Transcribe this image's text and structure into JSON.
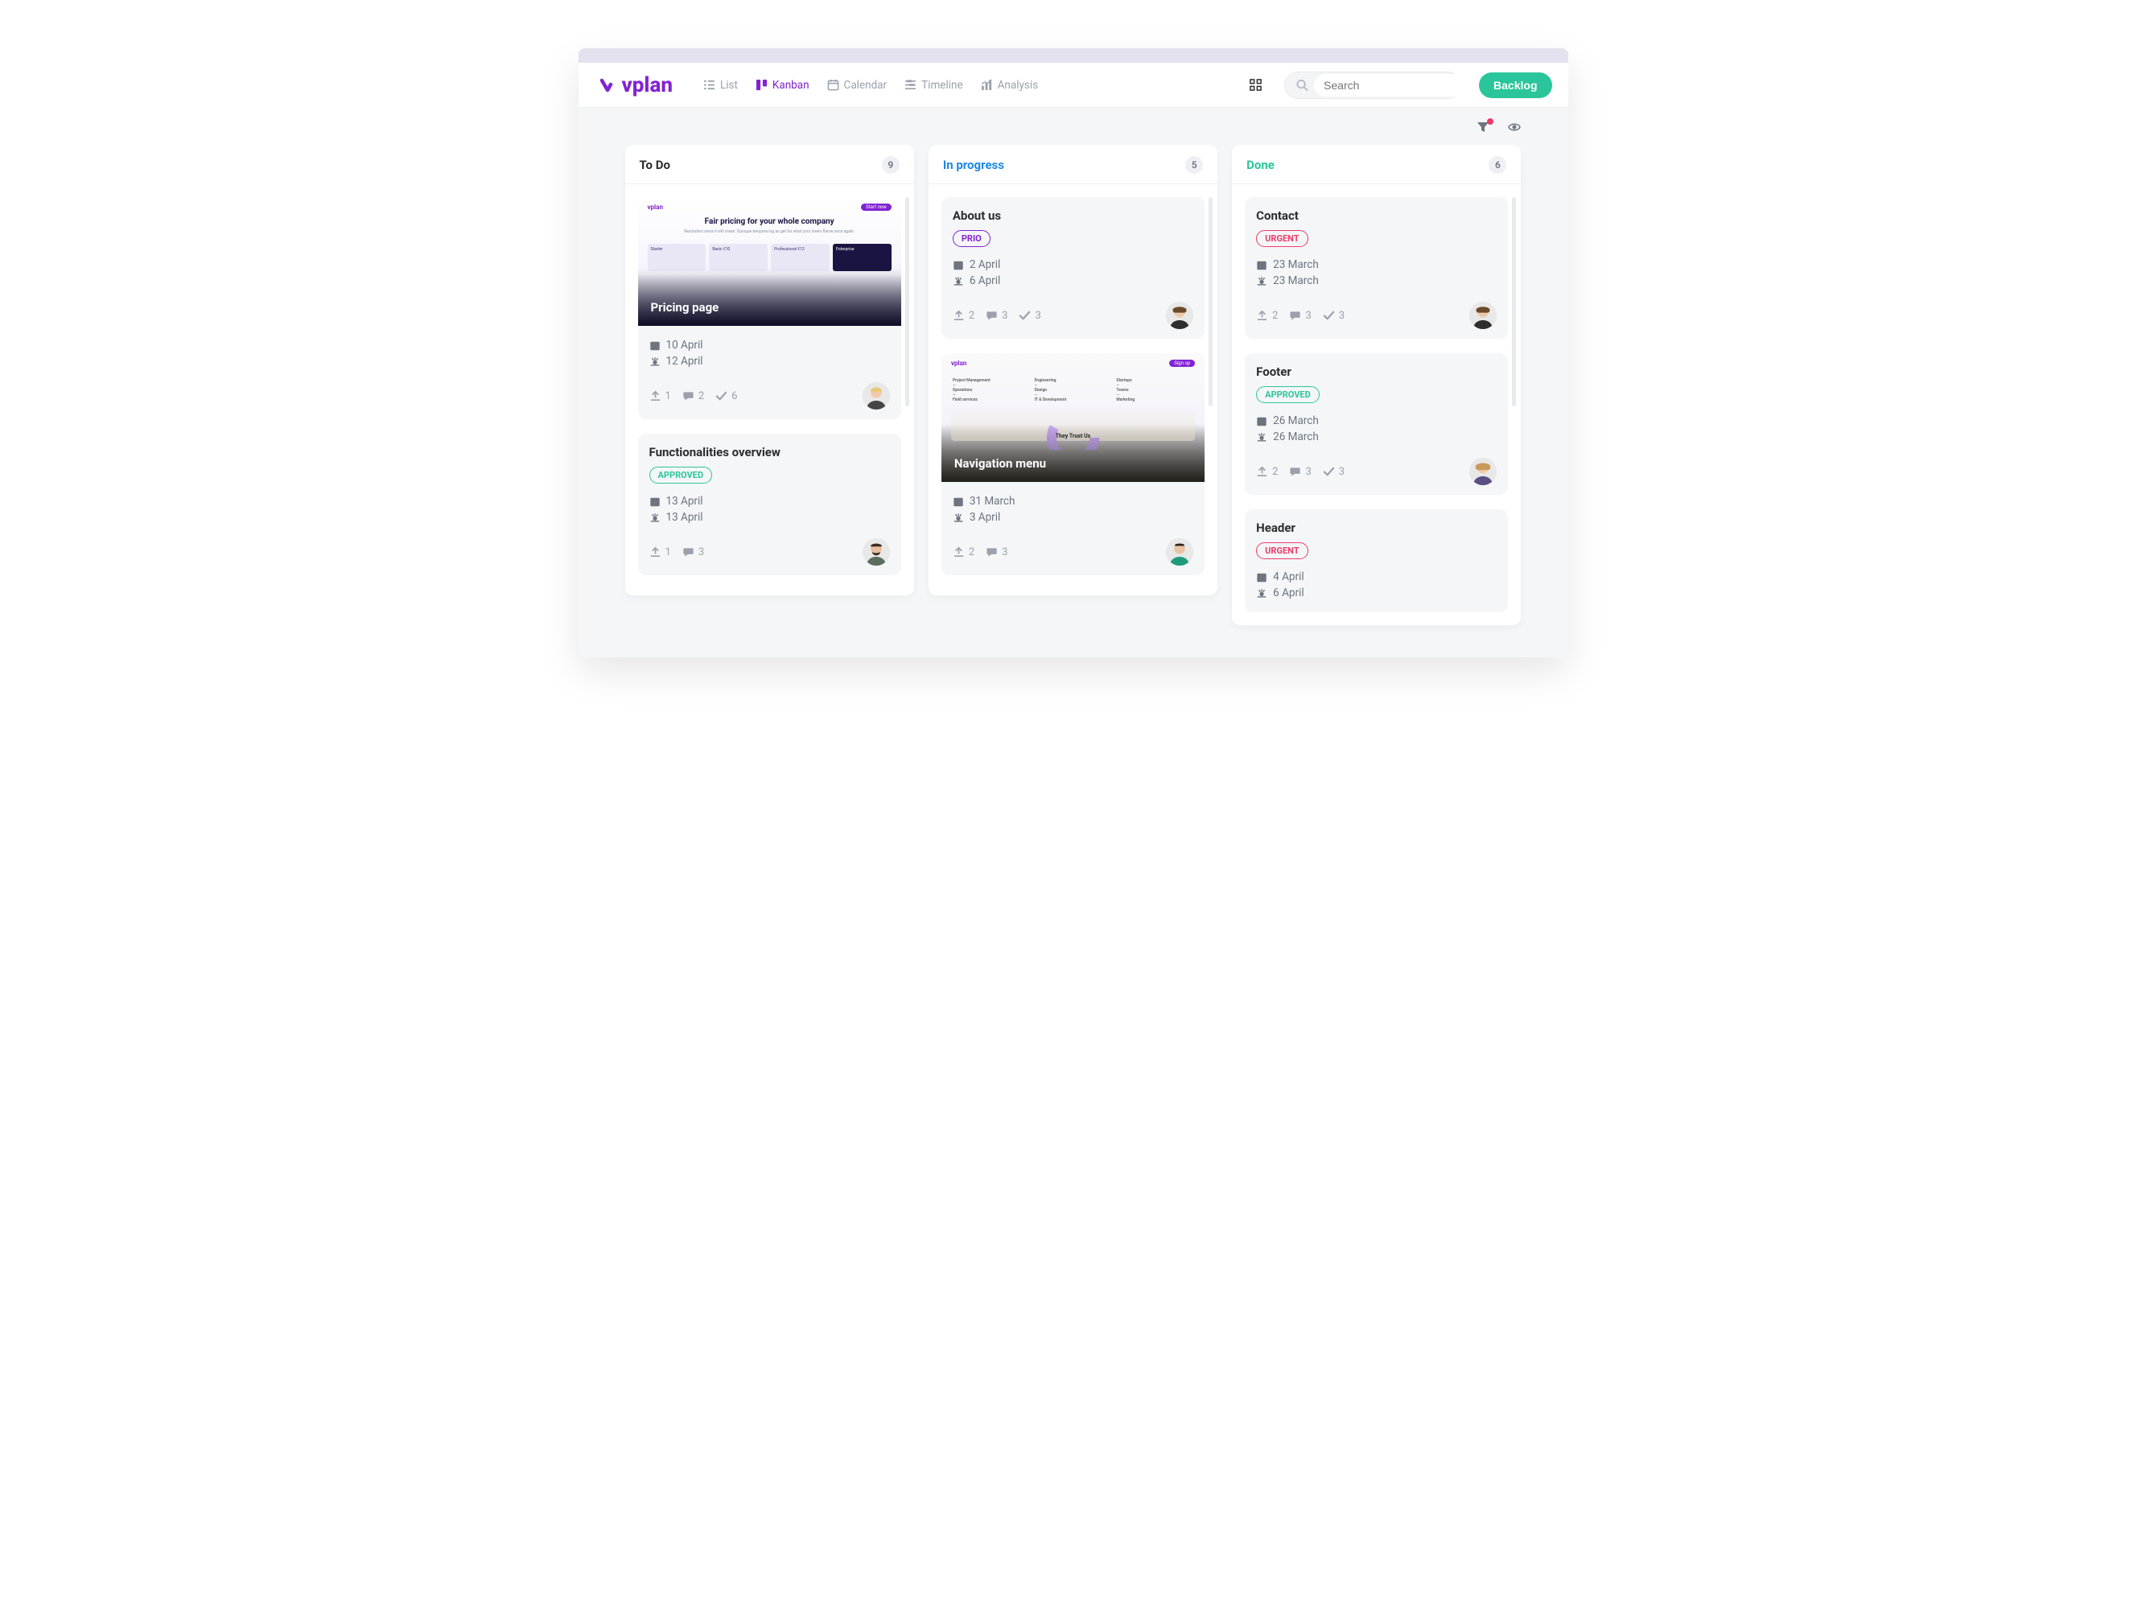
{
  "app": {
    "name": "vplan"
  },
  "nav": {
    "views": {
      "list": "List",
      "kanban": "Kanban",
      "calendar": "Calendar",
      "timeline": "Timeline",
      "analysis": "Analysis"
    },
    "active_view": "kanban",
    "search_placeholder": "Search",
    "backlog_label": "Backlog"
  },
  "board": {
    "columns": [
      {
        "key": "todo",
        "title": "To Do",
        "count": "9",
        "cards": [
          {
            "type": "image",
            "title": "Pricing page",
            "dates": {
              "start": "10 April",
              "end": "12 April"
            },
            "counts": {
              "uploads": "1",
              "comments": "2",
              "tasks": "6"
            },
            "thumb_heading": "Fair pricing for your whole company",
            "thumb_plans": [
              "Starter",
              "Basic €10",
              "Professional €12",
              "Enterprise"
            ]
          },
          {
            "type": "plain",
            "title": "Functionalities overview",
            "tag": {
              "style": "approved",
              "text": "APPROVED"
            },
            "dates": {
              "start": "13 April",
              "end": "13 April"
            },
            "counts": {
              "uploads": "1",
              "comments": "3"
            }
          }
        ]
      },
      {
        "key": "progress",
        "title": "In progress",
        "count": "5",
        "cards": [
          {
            "type": "plain",
            "title": "About us",
            "tag": {
              "style": "prio",
              "text": "PRIO"
            },
            "dates": {
              "start": "2 April",
              "end": "6 April"
            },
            "counts": {
              "uploads": "2",
              "comments": "3",
              "tasks": "3"
            }
          },
          {
            "type": "image",
            "title": "Navigation menu",
            "dates": {
              "start": "31 March",
              "end": "3 April"
            },
            "counts": {
              "uploads": "2",
              "comments": "3"
            },
            "thumb_trust": "They Trust Us"
          }
        ]
      },
      {
        "key": "done",
        "title": "Done",
        "count": "6",
        "cards": [
          {
            "type": "plain",
            "title": "Contact",
            "tag": {
              "style": "urgent",
              "text": "URGENT"
            },
            "dates": {
              "start": "23 March",
              "end": "23 March"
            },
            "counts": {
              "uploads": "2",
              "comments": "3",
              "tasks": "3"
            }
          },
          {
            "type": "plain",
            "title": "Footer",
            "tag": {
              "style": "approved",
              "text": "APPROVED"
            },
            "dates": {
              "start": "26 March",
              "end": "26 March"
            },
            "counts": {
              "uploads": "2",
              "comments": "3",
              "tasks": "3"
            }
          },
          {
            "type": "plain",
            "title": "Header",
            "tag": {
              "style": "urgent",
              "text": "URGENT"
            },
            "dates": {
              "start": "4 April",
              "end": "6 April"
            }
          }
        ]
      }
    ]
  },
  "avatars": {
    "blonde": {
      "skin": "#F3C8A8",
      "hair": "#E8C874",
      "shirt": "#454545"
    },
    "brown": {
      "skin": "#E9BDA0",
      "hair": "#3E2D1F",
      "shirt": "#5B6E5E"
    },
    "woman2": {
      "skin": "#F0C9AB",
      "hair": "#6B4A2C",
      "shirt": "#2E2E2E"
    },
    "woman3": {
      "skin": "#F1CCB0",
      "hair": "#C79A5B",
      "shirt": "#5A4E84"
    },
    "man2": {
      "skin": "#ECC1A3",
      "hair": "#2B231C",
      "shirt": "#1F9B7C"
    }
  }
}
